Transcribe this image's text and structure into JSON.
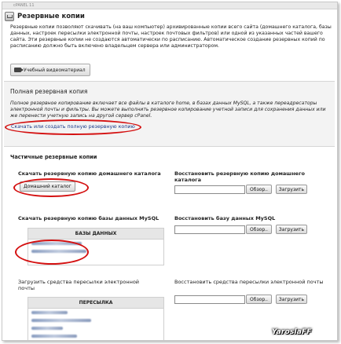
{
  "window": {
    "topbar_text": "cPANEL 11"
  },
  "page": {
    "title": "Резервные копии",
    "intro": "Резервные копии позволяют скачивать (на ваш компьютер) архивированные копии всего сайта (домашнего каталога, базы данных, настроек пересылки электронной почты, настроек почтовых фильтров) или одной из указанных частей вашего сайта. Эти резервные копии не создаются автоматически по расписанию. Автоматическое создание резервных копий по расписанию должно быть включено владельцем сервера или администратором.",
    "video_button": "Учебный видеоматериал"
  },
  "full_backup": {
    "title": "Полная резервная копия",
    "description": "Полное резервное копирование включает все файлы в каталоге home, в базах данных MySQL, а также переадресаторы электронной почты и фильтры. Вы можете выполнить резервное копирование учетной записи для сохранения данных или же перенести учетную запись на другой сервер cPanel.",
    "link": "Скачать или создать полную резервную копию"
  },
  "partial": {
    "title": "Частичные резервные копии",
    "home": {
      "download_title": "Скачать резервную копию домашнего каталога",
      "download_button": "Домашний каталог",
      "restore_title": "Восстановить резервную копию домашнего каталога",
      "browse": "Обзор..",
      "upload": "Загрузить"
    },
    "mysql": {
      "download_title": "Скачать резервную копию базы данных MySQL",
      "table_header": "БАЗЫ ДАННЫХ",
      "restore_title": "Восстановить базу данных MySQL",
      "browse": "Обзор..",
      "upload": "Загрузить"
    },
    "forwarders": {
      "download_title": "Загрузить средства пересылки электронной почты",
      "table_header": "ПЕРЕСЫЛКА",
      "restore_title": "Восстановить средства пересылки электронной почты",
      "browse": "Обзор..",
      "upload": "Загрузить"
    }
  },
  "watermark": "YaroslaFF",
  "colors": {
    "annotation_red": "#d41010",
    "link_blue": "#1a3a8a"
  }
}
